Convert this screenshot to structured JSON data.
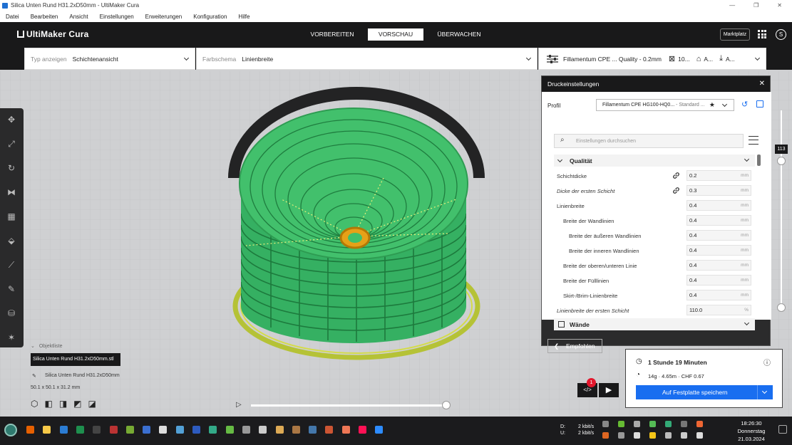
{
  "window": {
    "title": "Silica Unten Rund H31.2xD50mm - UltiMaker Cura",
    "controls": [
      "—",
      "❐",
      "✕"
    ]
  },
  "menu": [
    "Datei",
    "Bearbeiten",
    "Ansicht",
    "Einstellungen",
    "Erweiterungen",
    "Konfiguration",
    "Hilfe"
  ],
  "header": {
    "logo": "UltiMaker Cura",
    "stages": [
      {
        "label": "VORBEREITEN",
        "active": false
      },
      {
        "label": "VORSCHAU",
        "active": true
      },
      {
        "label": "ÜBERWACHEN",
        "active": false
      }
    ],
    "marketplace": "Marktplatz",
    "account_initial": "S"
  },
  "viewbar": {
    "view_type_label": "Typ anzeigen",
    "view_type_value": "Schichtenansicht",
    "color_scheme_label": "Farbschema",
    "color_scheme_value": "Linienbreite",
    "material_summary": "Fillamentum CPE ... Quality - 0.2mm",
    "infill_value": "10...",
    "support_value": "A...",
    "adhesion_value": "A..."
  },
  "panel": {
    "title": "Druckeinstellungen",
    "profile_label": "Profil",
    "profile_value": "Fillamentum CPE HG100-HQ0...",
    "profile_variant": "- Standard ...",
    "search_placeholder": "Einstellungen durchsuchen",
    "section_quality": "Qualität",
    "section_walls": "Wände",
    "recommended_button": "Empfohlen",
    "settings": [
      {
        "label": "Schichtdicke",
        "value": "0.2",
        "unit": "mm",
        "indent": 0,
        "italic": false,
        "linked": true
      },
      {
        "label": "Dicke der ersten Schicht",
        "value": "0.3",
        "unit": "mm",
        "indent": 0,
        "italic": true,
        "linked": true
      },
      {
        "label": "Linienbreite",
        "value": "0.4",
        "unit": "mm",
        "indent": 0,
        "italic": false,
        "linked": false
      },
      {
        "label": "Breite der Wandlinien",
        "value": "0.4",
        "unit": "mm",
        "indent": 1,
        "italic": false,
        "linked": false
      },
      {
        "label": "Breite der äußeren Wandlinien",
        "value": "0.4",
        "unit": "mm",
        "indent": 2,
        "italic": false,
        "linked": false
      },
      {
        "label": "Breite der inneren Wandlinien",
        "value": "0.4",
        "unit": "mm",
        "indent": 2,
        "italic": false,
        "linked": false
      },
      {
        "label": "Breite der oberen/unteren Linie",
        "value": "0.4",
        "unit": "mm",
        "indent": 1,
        "italic": false,
        "linked": false
      },
      {
        "label": "Breite der Fülllinien",
        "value": "0.4",
        "unit": "mm",
        "indent": 1,
        "italic": false,
        "linked": false
      },
      {
        "label": "Skirt-/Brim-Linienbreite",
        "value": "0.4",
        "unit": "mm",
        "indent": 1,
        "italic": false,
        "linked": false
      },
      {
        "label": "Linienbreite der ersten Schicht",
        "value": "110.0",
        "unit": "%",
        "indent": 0,
        "italic": true,
        "linked": false
      }
    ]
  },
  "layer_slider": {
    "value": "113"
  },
  "objects": {
    "header": "Objektliste",
    "file": "Silica Unten Rund H31.2xD50mm.stl",
    "item": "Silica Unten Rund H31.2xD50mm",
    "dimensions": "50.1 x 50.1 x 31.2 mm"
  },
  "print": {
    "time": "1 Stunde 19 Minuten",
    "details": "14g · 4.65m · CHF 0.67",
    "save_button": "Auf Festplatte speichern",
    "notification_count": "1"
  },
  "taskbar": {
    "net_down_label": "D:",
    "net_up_label": "U:",
    "net_down": "2 kbit/s",
    "net_up": "2 kbit/s",
    "time": "18:26:30",
    "day": "Donnerstag",
    "date": "21.03.2024"
  },
  "colors": {
    "accent": "#196ef0",
    "header_bg": "#19191a",
    "model_green": "#3fbf6a",
    "model_yellow": "#c8d23c"
  }
}
